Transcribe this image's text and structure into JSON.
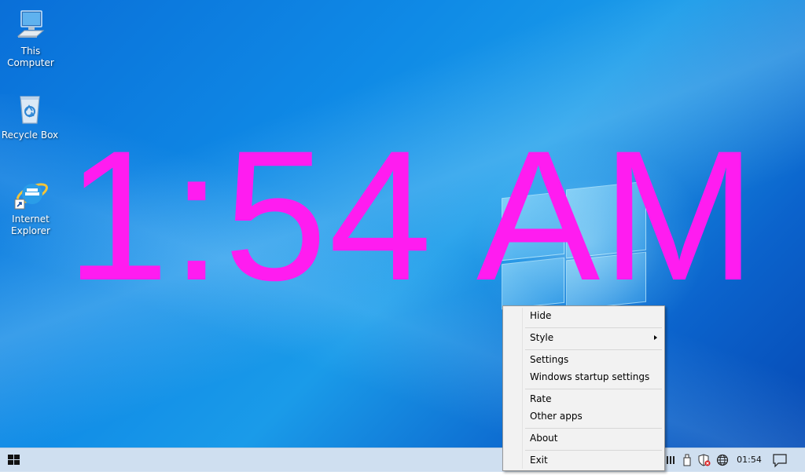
{
  "desktop": {
    "icons": [
      {
        "label": "This Computer",
        "icon": "computer-icon"
      },
      {
        "label": "Recycle Box",
        "icon": "recycle-bin-icon"
      },
      {
        "label": "Internet Explorer",
        "icon": "internet-explorer-icon"
      }
    ]
  },
  "clock_overlay": {
    "time": "1:54 AM",
    "color": "#ff1cf0"
  },
  "context_menu": {
    "items": [
      {
        "label": "Hide"
      },
      {
        "label": "Style",
        "has_submenu": true
      },
      {
        "label": "Settings"
      },
      {
        "label": "Windows startup settings"
      },
      {
        "label": "Rate"
      },
      {
        "label": "Other apps"
      },
      {
        "label": "About"
      },
      {
        "label": "Exit"
      }
    ]
  },
  "taskbar": {
    "start_icon": "windows-logo-icon",
    "tray_icons": [
      "taskbar-pin-icon",
      "usb-drive-icon",
      "security-shield-icon",
      "network-globe-icon"
    ],
    "clock": "01:54",
    "notification_icon": "action-center-icon",
    "background": "#cfdff0"
  }
}
